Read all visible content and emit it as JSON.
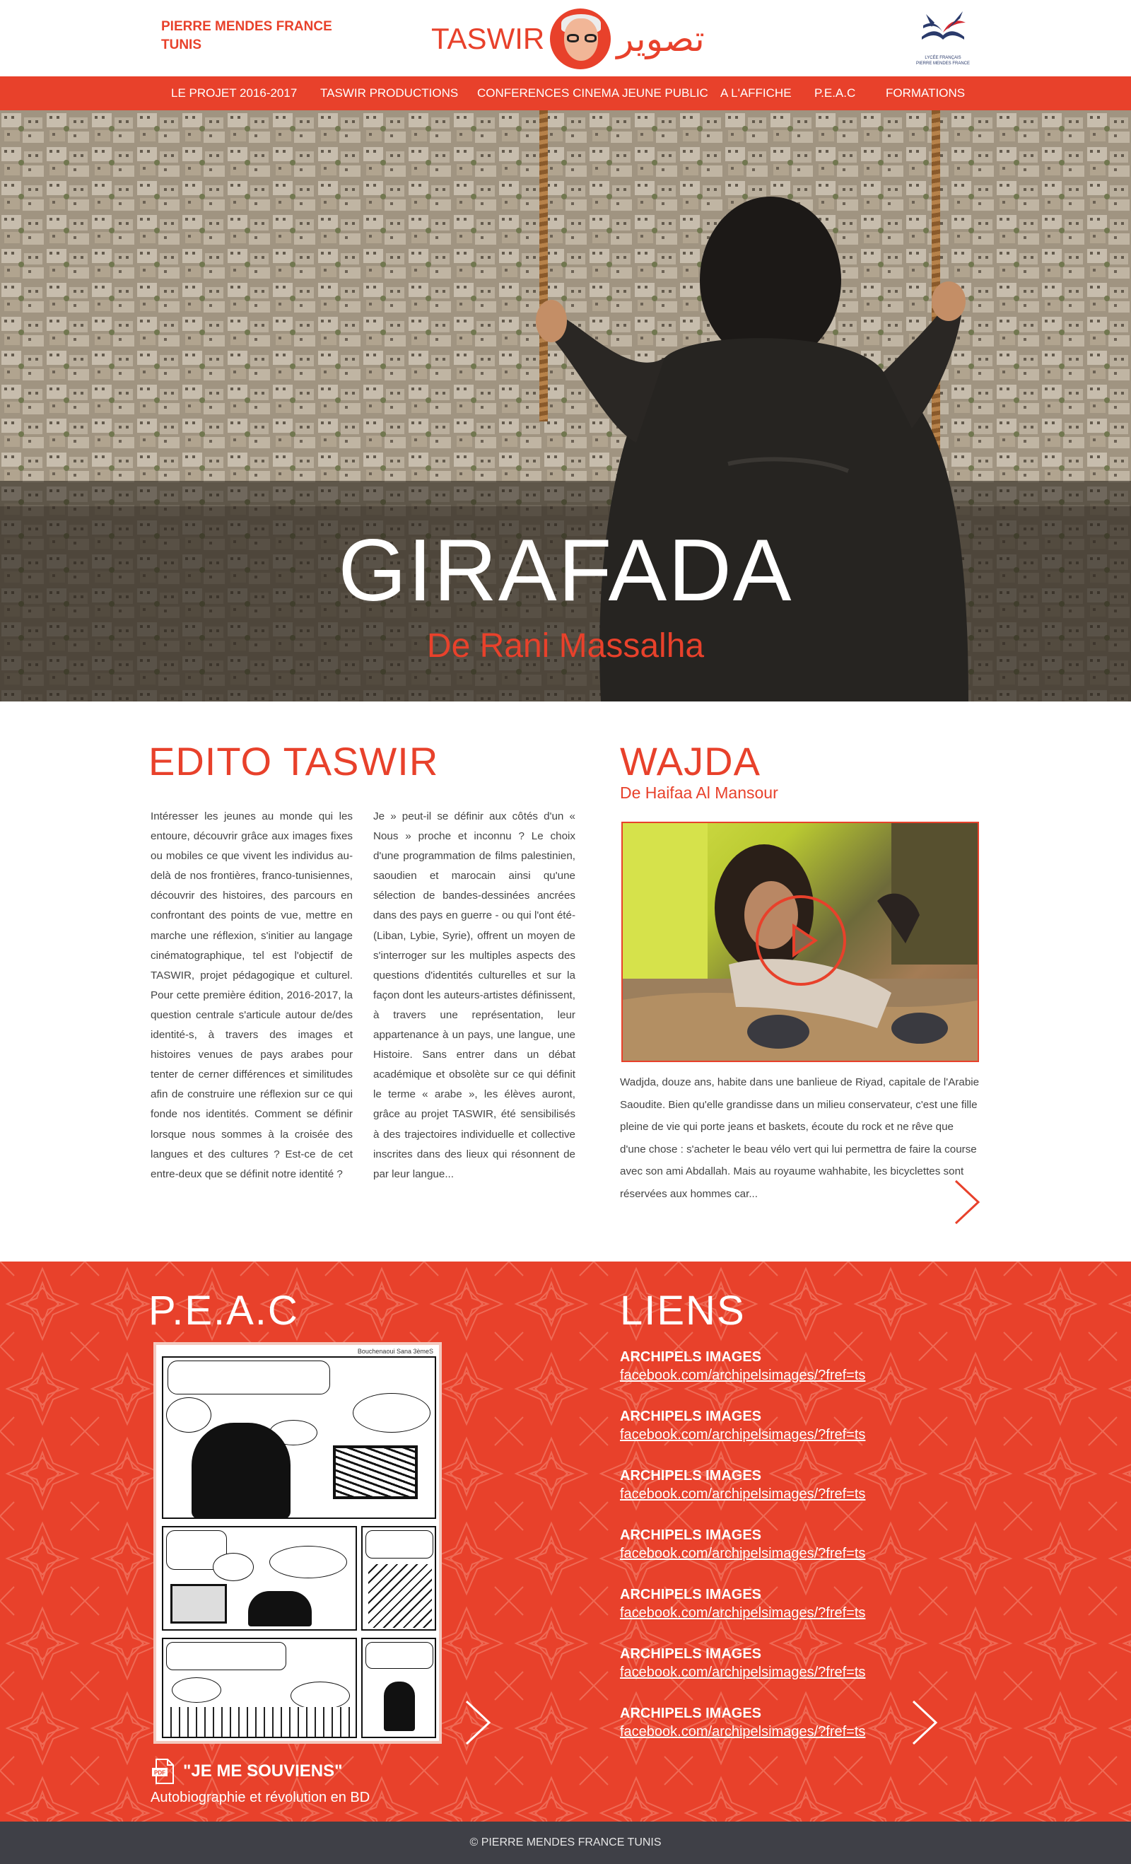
{
  "header": {
    "school_line1": "PIERRE MENDES FRANCE",
    "school_line2": "TUNIS",
    "logo_latin": "TASWIR",
    "logo_arabic": "تصوير",
    "lycee_caption_1": "LYCÉE FRANÇAIS",
    "lycee_caption_2": "PIERRE MENDES FRANCE"
  },
  "nav": {
    "items": [
      {
        "label": "LE  PROJET 2016-2017"
      },
      {
        "label": "TASWIR PRODUCTIONS"
      },
      {
        "label": "CONFERENCES CINEMA JEUNE PUBLIC"
      },
      {
        "label": "A L'AFFICHE"
      },
      {
        "label": "P.E.A.C"
      },
      {
        "label": "FORMATIONS"
      }
    ]
  },
  "hero": {
    "title": "GIRAFADA",
    "subtitle": "De Rani Massalha"
  },
  "edito": {
    "title": "EDITO TASWIR",
    "column1": "Intéresser les jeunes au monde qui les entoure, découvrir grâce aux images fixes ou mobiles ce que vivent les individus au-delà de nos frontières, franco-tunisiennes, découvrir des histoires, des parcours en confrontant des points de vue, mettre en marche une réflexion, s'initier au langage cinématographique, tel est l'objectif de TASWIR, projet pédagogique et culturel. Pour cette première édition, 2016-2017, la question centrale s'articule autour de/des identité-s, à travers des images et histoires venues de pays arabes pour tenter de cerner différences et similitudes afin de construire une réflexion sur ce qui fonde nos identités. Comment se définir lorsque nous sommes à la croisée des langues et des cultures ? Est-ce de cet entre-deux que se définit notre identité ?",
    "column2": "Je » peut-il se définir aux côtés d'un « Nous » proche et inconnu ? Le choix d'une programmation de films palestinien, saoudien et marocain ainsi qu'une sélection de bandes-dessinées ancrées dans des pays en guerre - ou qui l'ont été- (Liban, Lybie, Syrie), offrent un moyen de s'interroger sur les multiples aspects des questions d'identités culturelles et sur la façon dont les auteurs-artistes définissent, à travers une représentation, leur appartenance à un pays, une langue, une Histoire. Sans entrer dans un débat académique et obsolète sur ce qui définit le terme « arabe », les élèves auront, grâce au projet TASWIR, été sensibilisés à des trajectoires individuelle et collective inscrites dans des lieux qui résonnent de par leur langue..."
  },
  "wajda": {
    "title": "WAJDA",
    "subtitle": "De Haifaa Al Mansour",
    "description": "Wadjda, douze ans, habite dans une banlieue de Riyad, capitale de l'Arabie Saoudite. Bien qu'elle grandisse dans un milieu conservateur, c'est une fille pleine de vie qui porte jeans et baskets, écoute du rock et ne rêve que d'une chose : s'acheter le beau vélo vert qui lui permettra de faire la course avec son ami Abdallah.  Mais au royaume wahhabite, les bicyclettes sont réservées aux hommes car..."
  },
  "peac": {
    "title": "P.E.A.C",
    "comic_credit": "Bouchenaoui Sana 3èmeS",
    "doc_badge": "PDF",
    "doc_title": "\"JE ME SOUVIENS\"",
    "doc_subtitle": "Autobiographie et révolution en BD"
  },
  "liens": {
    "title": "LIENS",
    "items": [
      {
        "name": "ARCHIPELS IMAGES",
        "url": "facebook.com/archipelsimages/?fref=ts"
      },
      {
        "name": "ARCHIPELS IMAGES",
        "url": "facebook.com/archipelsimages/?fref=ts"
      },
      {
        "name": "ARCHIPELS IMAGES",
        "url": "facebook.com/archipelsimages/?fref=ts"
      },
      {
        "name": "ARCHIPELS IMAGES",
        "url": "facebook.com/archipelsimages/?fref=ts"
      },
      {
        "name": "ARCHIPELS IMAGES",
        "url": "facebook.com/archipelsimages/?fref=ts"
      },
      {
        "name": "ARCHIPELS IMAGES",
        "url": "facebook.com/archipelsimages/?fref=ts"
      },
      {
        "name": "ARCHIPELS IMAGES",
        "url": "facebook.com/archipelsimages/?fref=ts"
      }
    ]
  },
  "footer": {
    "copyright": "© PIERRE MENDES FRANCE TUNIS"
  },
  "colors": {
    "accent": "#e8412b",
    "footer_bg": "#3f4047",
    "text": "#444444"
  },
  "icons": [
    "pdf-icon",
    "chevron-right-icon",
    "play-icon"
  ]
}
